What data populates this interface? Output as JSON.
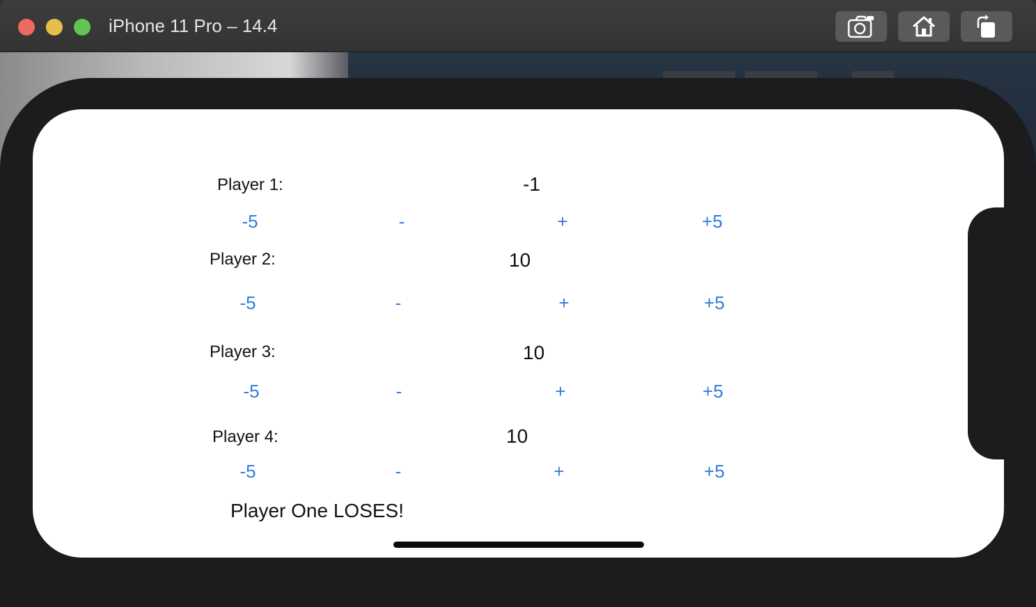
{
  "window": {
    "title": "iPhone 11 Pro – 14.4"
  },
  "toolbar": {
    "screenshot_icon": "camera-icon",
    "home_icon": "home-icon",
    "rotate_icon": "rotate-icon"
  },
  "colors": {
    "button_blue": "#2f7ce0",
    "device_frame": "#1c1c1e"
  },
  "players": [
    {
      "label": "Player 1:",
      "score": "-1",
      "buttons": [
        "-5",
        "-",
        "+",
        "+5"
      ]
    },
    {
      "label": "Player 2:",
      "score": "10",
      "buttons": [
        "-5",
        "-",
        "+",
        "+5"
      ]
    },
    {
      "label": "Player 3:",
      "score": "10",
      "buttons": [
        "-5",
        "-",
        "+",
        "+5"
      ]
    },
    {
      "label": "Player 4:",
      "score": "10",
      "buttons": [
        "-5",
        "-",
        "+",
        "+5"
      ]
    }
  ],
  "result_text": "Player One LOSES!"
}
